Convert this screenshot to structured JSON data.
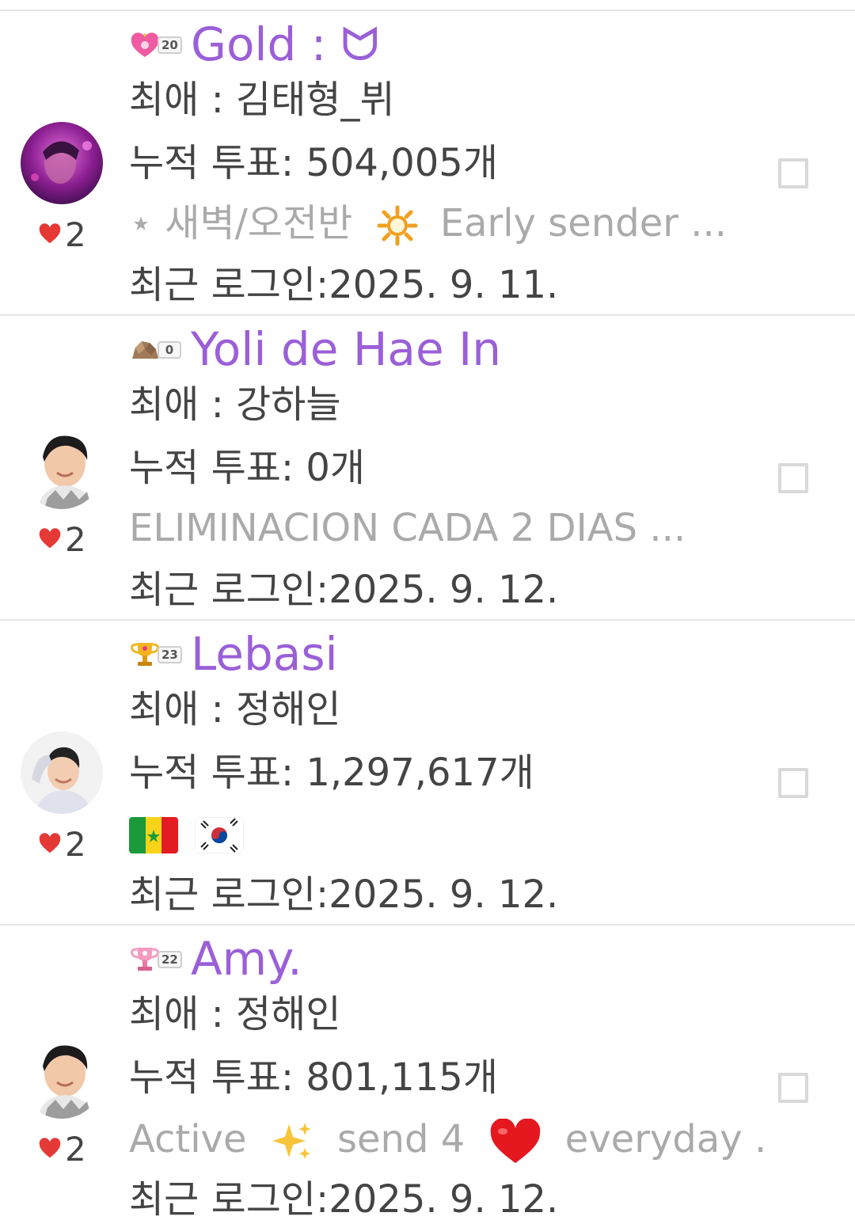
{
  "users": [
    {
      "nickname": "Gold : ᗢ",
      "badge_level": "20",
      "favorite": "최애 : 김태형_뷔",
      "votes": "누적 투표: 504,005개",
      "status_parts": [
        "⋆ 새벽/오전반",
        "Early sender ..."
      ],
      "last_login": "최근 로그인:2025. 9. 11.",
      "likes": "2",
      "icons": {
        "badge": "heart-crown-badge-icon",
        "status_emoji": "sun-icon"
      }
    },
    {
      "nickname": "Yoli de Hae In",
      "badge_level": "0",
      "favorite": "최애 : 강하늘",
      "votes": "누적 투표: 0개",
      "status": "ELIMINACION CADA 2 DIAS ...",
      "last_login": "최근 로그인:2025. 9. 12.",
      "likes": "2",
      "icons": {
        "badge": "rock-badge-icon"
      }
    },
    {
      "nickname": "Lebasi",
      "badge_level": "23",
      "favorite": "최애 : 정해인",
      "votes": "누적 투표: 1,297,617개",
      "last_login": "최근 로그인:2025. 9. 12.",
      "likes": "2",
      "icons": {
        "badge": "gold-trophy-badge-icon",
        "status_flags": [
          "senegal-flag-icon",
          "south-korea-flag-icon"
        ]
      }
    },
    {
      "nickname": "Amy.",
      "badge_level": "22",
      "favorite": "최애 : 정해인",
      "votes": "누적 투표: 801,115개",
      "status_parts": [
        "Active",
        "send 4",
        "everyday ..."
      ],
      "last_login": "최근 로그인:2025. 9. 12.",
      "likes": "2",
      "icons": {
        "badge": "pink-trophy-badge-icon",
        "status_emojis": [
          "sparkles-icon",
          "red-heart-icon"
        ]
      }
    }
  ],
  "colors": {
    "nickname": "#9b5fd8",
    "text": "#444444",
    "muted": "#aaaaaa",
    "heart": "#e53935",
    "divider": "#e6e6e6"
  }
}
